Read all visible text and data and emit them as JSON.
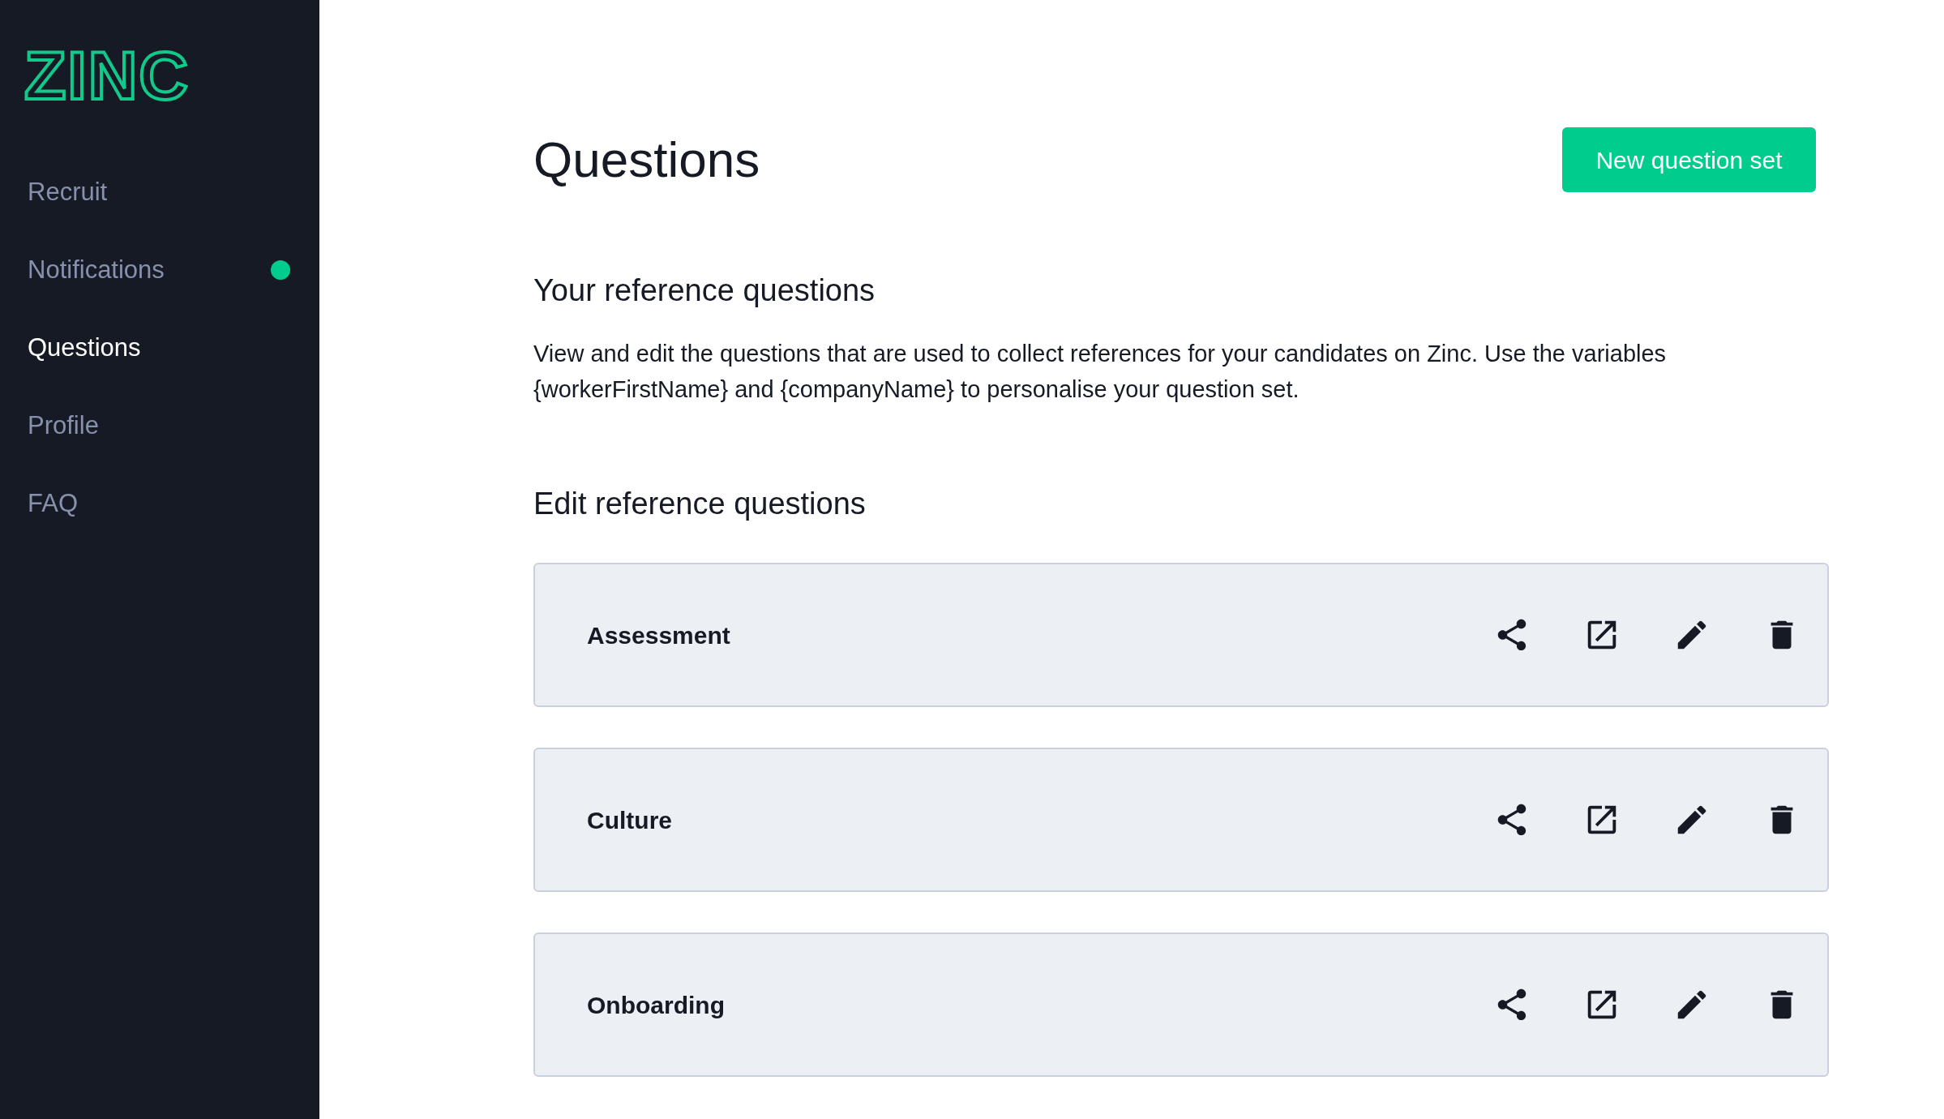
{
  "sidebar": {
    "logo": "ZINC",
    "items": [
      {
        "label": "Recruit",
        "selected": false,
        "unread": false
      },
      {
        "label": "Notifications",
        "selected": false,
        "unread": true
      },
      {
        "label": "Questions",
        "selected": true,
        "unread": false
      },
      {
        "label": "Profile",
        "selected": false,
        "unread": false
      },
      {
        "label": "FAQ",
        "selected": false,
        "unread": false
      }
    ]
  },
  "header": {
    "title": "Questions",
    "button": "New question set"
  },
  "intro": {
    "heading": "Your reference questions",
    "text": "View and edit the questions that are used to collect references for your candidates on Zinc. Use the variables {workerFirstName} and {companyName} to personalise your question set."
  },
  "edit_section": {
    "heading": "Edit reference questions",
    "question_sets": [
      {
        "name": "Assessment"
      },
      {
        "name": "Culture"
      },
      {
        "name": "Onboarding"
      }
    ]
  }
}
